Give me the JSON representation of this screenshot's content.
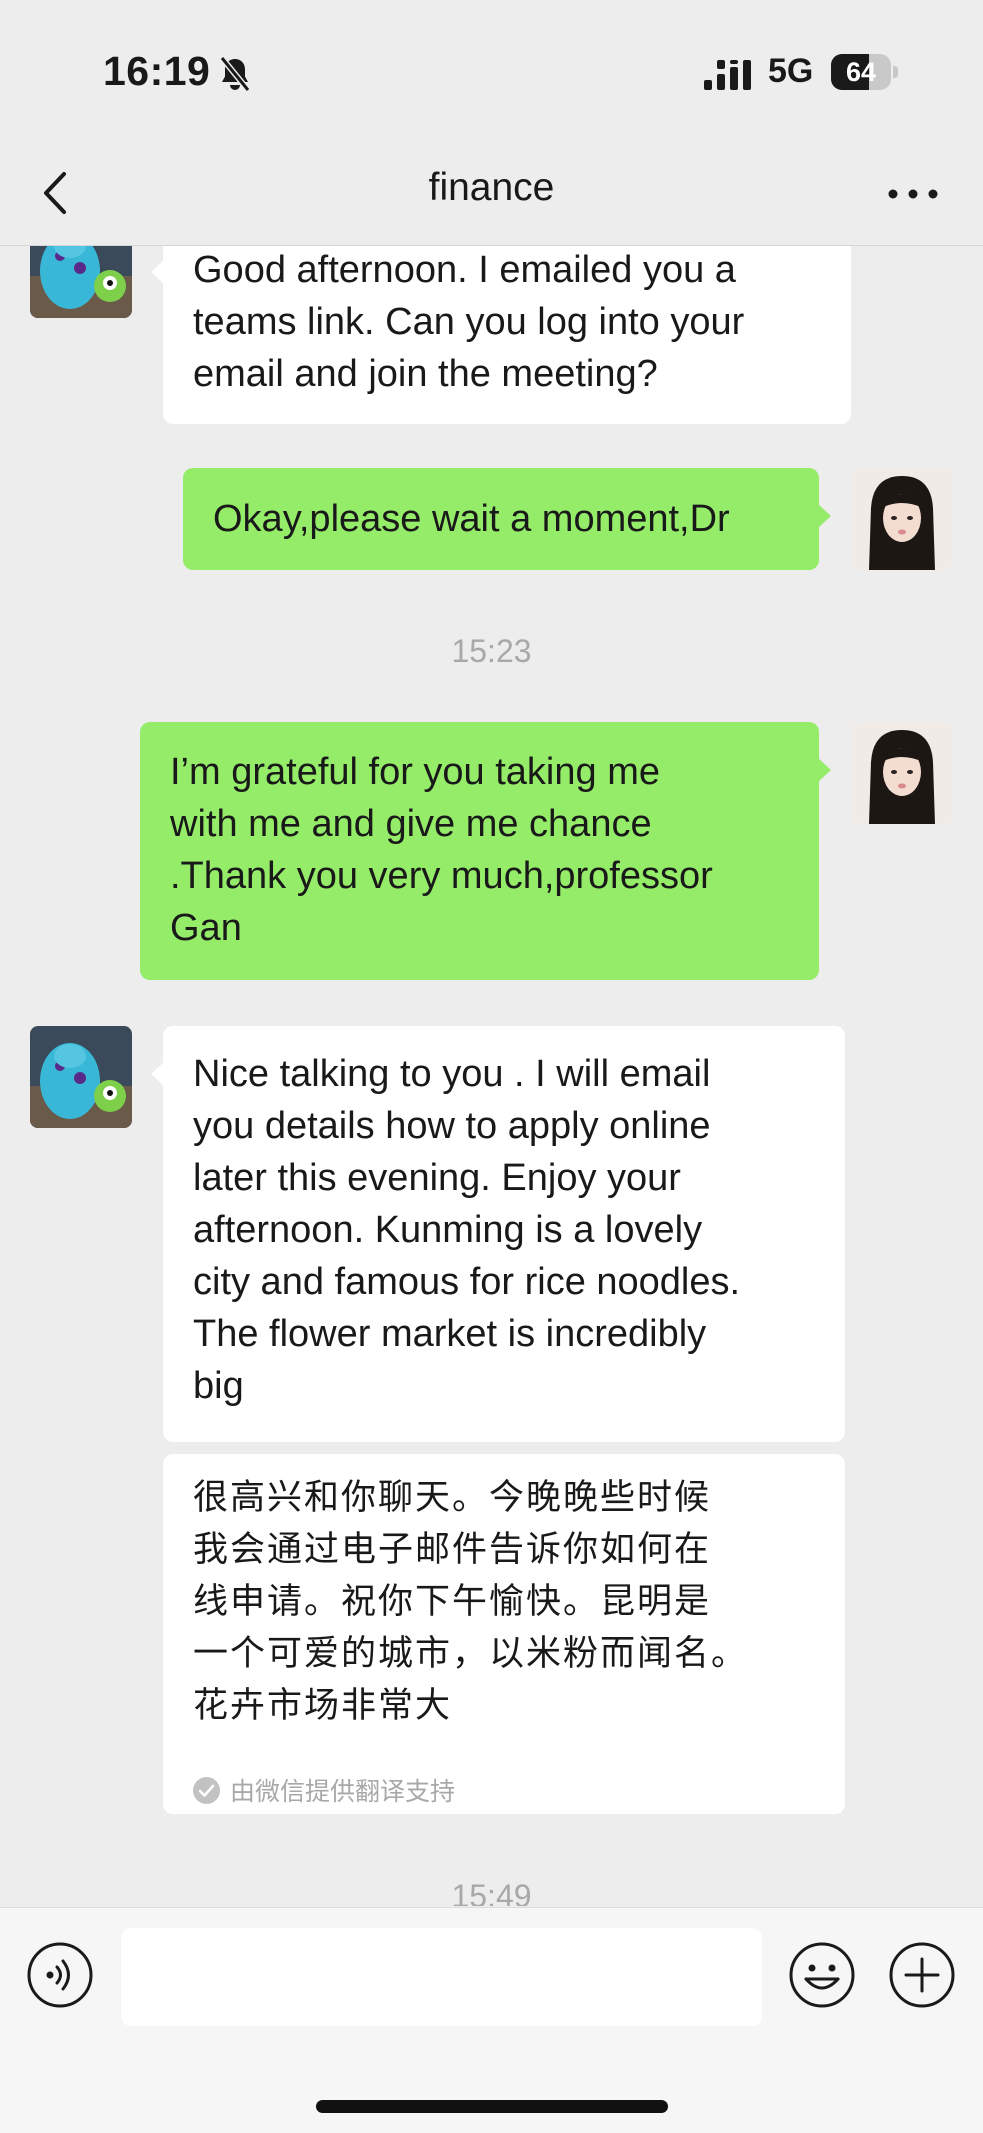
{
  "status": {
    "time": "16:19",
    "network": "5G",
    "battery": "64",
    "battery_fraction": 0.64
  },
  "header": {
    "title": "finance"
  },
  "messages": {
    "m1": {
      "text": "Good afternoon. I emailed you a\nteams link. Can you log into your\nemail and join the meeting?"
    },
    "m2": {
      "text": "Okay,please wait a moment,Dr"
    },
    "time1": "15:23",
    "m3": {
      "text": "I’m grateful for you taking me\nwith me and give me chance\n.Thank you very much,professor\nGan"
    },
    "m4": {
      "text": "Nice talking to you . I will email\nyou details how to apply online\nlater this evening. Enjoy your\nafternoon. Kunming is a lovely\ncity and famous for rice noodles.\nThe flower market is incredibly\nbig"
    },
    "m4_translation": {
      "text": "很高兴和你聊天。今晚晚些时候\n我会通过电子邮件告诉你如何在\n线申请。祝你下午愉快。昆明是\n一个可爱的城市，以米粉而闻名。\n花卉市场非常大",
      "note": "由微信提供翻译支持"
    },
    "time2": "15:49"
  },
  "input_bar": {
    "placeholder": ""
  },
  "colors": {
    "background": "#ededed",
    "bubble_in": "#ffffff",
    "bubble_out": "#95ec69",
    "timestamp": "#a8a8a8"
  },
  "icons": [
    "bell-slash-icon",
    "signal-icon",
    "battery-icon",
    "back-arrow-icon",
    "more-icon",
    "voice-icon",
    "emoji-icon",
    "plus-icon",
    "check-circle-icon"
  ]
}
